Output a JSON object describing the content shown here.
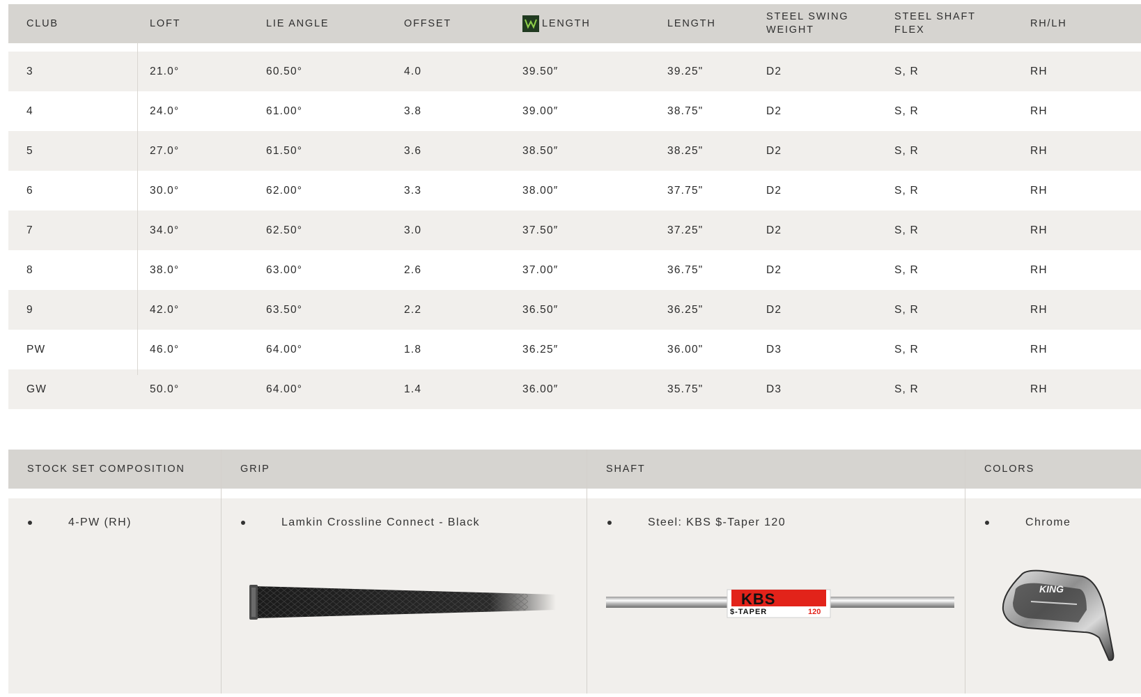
{
  "specs_table": {
    "headers": {
      "club": "CLUB",
      "loft": "LOFT",
      "lie": "LIE ANGLE",
      "offset": "OFFSET",
      "wlength": "LENGTH",
      "length": "LENGTH",
      "swing_weight": "STEEL SWING WEIGHT",
      "flex": "STEEL SHAFT FLEX",
      "hand": "RH/LH"
    },
    "rows": [
      {
        "club": "3",
        "loft": "21.0°",
        "lie": "60.50°",
        "offset": "4.0",
        "wlength": "39.50″",
        "length": "39.25\"",
        "sw": "D2",
        "flex": "S, R",
        "hand": "RH"
      },
      {
        "club": "4",
        "loft": "24.0°",
        "lie": "61.00°",
        "offset": "3.8",
        "wlength": "39.00″",
        "length": "38.75\"",
        "sw": "D2",
        "flex": "S, R",
        "hand": "RH"
      },
      {
        "club": "5",
        "loft": "27.0°",
        "lie": "61.50°",
        "offset": "3.6",
        "wlength": "38.50″",
        "length": "38.25\"",
        "sw": "D2",
        "flex": "S, R",
        "hand": "RH"
      },
      {
        "club": "6",
        "loft": "30.0°",
        "lie": "62.00°",
        "offset": "3.3",
        "wlength": "38.00″",
        "length": "37.75\"",
        "sw": "D2",
        "flex": "S, R",
        "hand": "RH"
      },
      {
        "club": "7",
        "loft": "34.0°",
        "lie": "62.50°",
        "offset": "3.0",
        "wlength": "37.50″",
        "length": "37.25\"",
        "sw": "D2",
        "flex": "S, R",
        "hand": "RH"
      },
      {
        "club": "8",
        "loft": "38.0°",
        "lie": "63.00°",
        "offset": "2.6",
        "wlength": "37.00″",
        "length": "36.75\"",
        "sw": "D2",
        "flex": "S, R",
        "hand": "RH"
      },
      {
        "club": "9",
        "loft": "42.0°",
        "lie": "63.50°",
        "offset": "2.2",
        "wlength": "36.50″",
        "length": "36.25\"",
        "sw": "D2",
        "flex": "S, R",
        "hand": "RH"
      },
      {
        "club": "PW",
        "loft": "46.0°",
        "lie": "64.00°",
        "offset": "1.8",
        "wlength": "36.25″",
        "length": "36.00\"",
        "sw": "D3",
        "flex": "S, R",
        "hand": "RH"
      },
      {
        "club": "GW",
        "loft": "50.0°",
        "lie": "64.00°",
        "offset": "1.4",
        "wlength": "36.00″",
        "length": "35.75\"",
        "sw": "D3",
        "flex": "S, R",
        "hand": "RH"
      }
    ]
  },
  "components": {
    "headers": {
      "stock_set": "STOCK SET COMPOSITION",
      "grip": "GRIP",
      "shaft": "SHAFT",
      "colors": "COLORS"
    },
    "stock_set": "4-PW (RH)",
    "grip": "Lamkin Crossline Connect - Black",
    "shaft": "Steel: KBS $-Taper 120",
    "colors": "Chrome",
    "shaft_brand": "KBS",
    "shaft_model": "$-TAPER",
    "shaft_weight": "120",
    "iron_brand": "KING"
  },
  "colors": {
    "header_bg": "#d6d4d0",
    "row_shaded": "#f1efec",
    "kbs_red": "#e2231a"
  }
}
